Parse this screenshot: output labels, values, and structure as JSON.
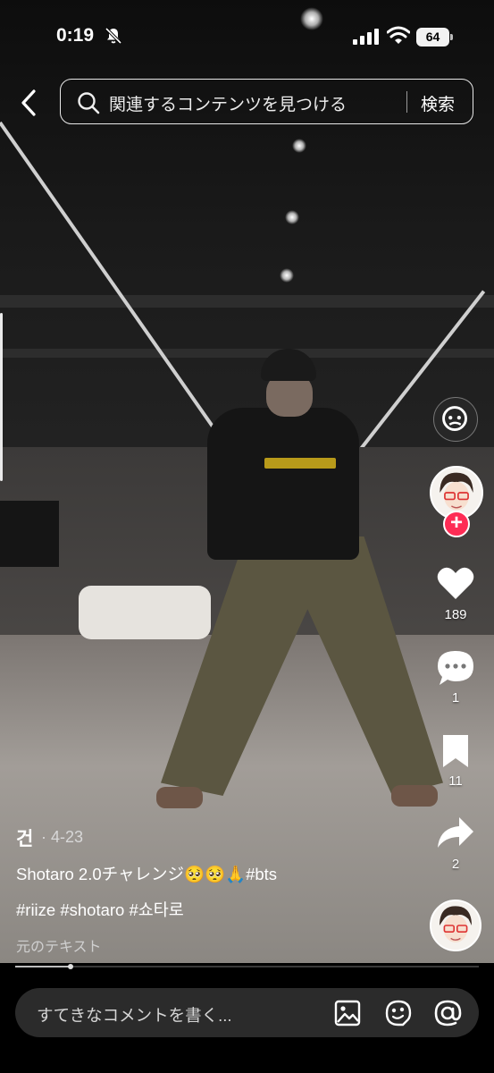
{
  "status_bar": {
    "time": "0:19",
    "battery": "64"
  },
  "search": {
    "placeholder": "関連するコンテンツを見つける",
    "button": "検索"
  },
  "rail": {
    "likes": "189",
    "comments": "1",
    "saves": "11",
    "shares": "2"
  },
  "post": {
    "author": "건",
    "date": "· 4-23",
    "caption_line1": "Shotaro 2.0チャレンジ🥺🥺🙏#bts",
    "caption_line2": "#riize #shotaro #쇼타로",
    "original_text_link": "元のテキスト"
  },
  "progress": {
    "played_fraction": 0.12
  },
  "comment": {
    "placeholder": "すてきなコメントを書く..."
  },
  "colors": {
    "accent": "#fe2c55",
    "background": "#000000"
  },
  "icons": [
    "mute-icon",
    "signal-icon",
    "wifi-icon",
    "back-icon",
    "search-icon",
    "scan-icon",
    "heart-icon",
    "comment-icon",
    "bookmark-icon",
    "share-icon",
    "image-icon",
    "sticker-icon",
    "mention-icon"
  ]
}
